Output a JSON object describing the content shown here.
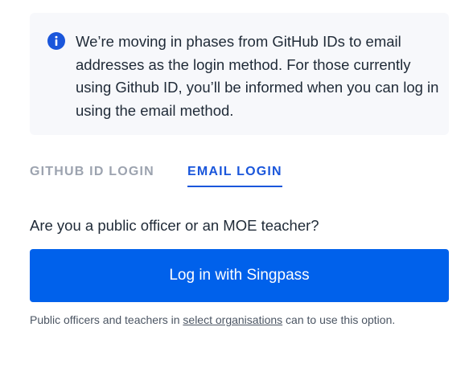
{
  "notice": {
    "text": "We’re moving in phases from GitHub IDs to email addresses as the login method. For those currently using Github ID, you’ll be informed when you can log in using the email method.",
    "icon": "info-icon",
    "icon_color": "#1a56db"
  },
  "tabs": [
    {
      "label": "GITHUB ID LOGIN",
      "active": false
    },
    {
      "label": "EMAIL LOGIN",
      "active": true
    }
  ],
  "question": "Are you a public officer or an MOE teacher?",
  "singpass_button": {
    "label": "Log in with Singpass",
    "color": "#0061eb"
  },
  "footnote": {
    "before": "Public officers and teachers in ",
    "link": "select organisations",
    "after": " can to use this option."
  }
}
